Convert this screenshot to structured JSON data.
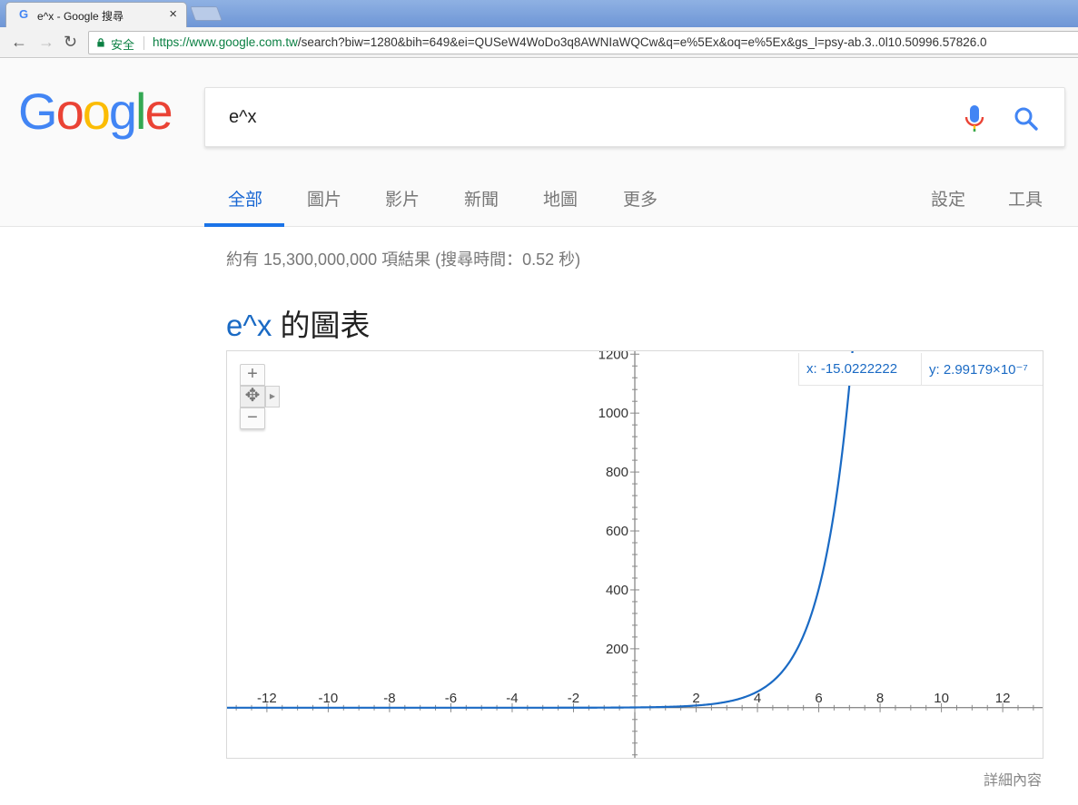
{
  "browser": {
    "tab_title": "e^x - Google 搜尋",
    "tab_close": "×",
    "secure_label": "安全",
    "url_scheme_host": "https://www.google.com.tw",
    "url_rest": "/search?biw=1280&bih=649&ei=QUSeW4WoDo3q8AWNIaWQCw&q=e%5Ex&oq=e%5Ex&gs_l=psy-ab.3..0l10.50996.57826.0"
  },
  "google": {
    "logo_letters": [
      "G",
      "o",
      "o",
      "g",
      "l",
      "e"
    ],
    "logo_colors": [
      "#4285f4",
      "#ea4335",
      "#fbbc05",
      "#4285f4",
      "#34a853",
      "#ea4335"
    ],
    "query": "e^x",
    "tabs": [
      {
        "label": "全部",
        "active": true
      },
      {
        "label": "圖片"
      },
      {
        "label": "影片"
      },
      {
        "label": "新聞"
      },
      {
        "label": "地圖"
      },
      {
        "label": "更多"
      }
    ],
    "right_tabs": [
      {
        "label": "設定"
      },
      {
        "label": "工具"
      }
    ]
  },
  "results": {
    "stats": "約有 15,300,000,000 項結果 (搜尋時間：0.52 秒)",
    "graph_query": "e^x",
    "graph_suffix": " 的圖表",
    "readout_x": "x: -15.0222222",
    "readout_y": "y: 2.99179×10⁻⁷",
    "more_link": "詳細內容"
  },
  "chart_data": {
    "type": "line",
    "function": "e^x",
    "series": [
      {
        "name": "",
        "x": [
          -13,
          -12,
          -10,
          -8,
          -6,
          -4,
          -2,
          0,
          1,
          2,
          3,
          4,
          5,
          6,
          6.5,
          7,
          7.1
        ],
        "y": [
          2.3e-06,
          6.1e-06,
          4.54e-05,
          0.000335,
          0.00248,
          0.0183,
          0.135,
          1,
          2.718,
          7.389,
          20.09,
          54.6,
          148.4,
          403.4,
          665.1,
          1096.6,
          1212
        ]
      }
    ],
    "xlim": [
      -13.3,
      13.3
    ],
    "ylim": [
      -170,
      1210
    ],
    "x_ticks": [
      -12,
      -10,
      -8,
      -6,
      -4,
      -2,
      2,
      4,
      6,
      8,
      10,
      12
    ],
    "y_ticks": [
      200,
      400,
      600,
      800,
      1000,
      1200
    ],
    "grid": false,
    "line_color": "#1a6ac4"
  }
}
